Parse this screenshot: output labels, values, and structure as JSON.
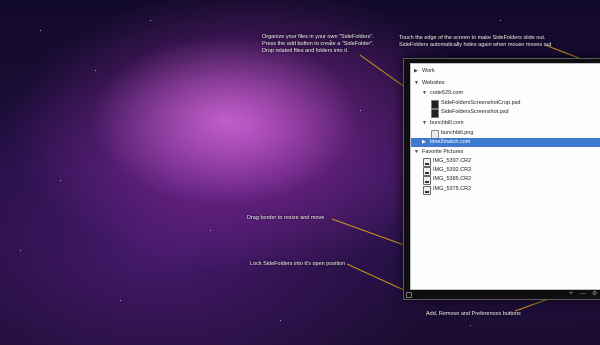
{
  "annotations": {
    "organize": "Organize your files in your own \"SideFolders\".\nPress the add button to create a \"SideFolder\".\nDrop related files and folders into it.",
    "touch_edge": "Touch the edge of the screen to make SideFolders slide out.\nSideFolders automatically hides again when mouse moves out",
    "drag_border": "Drag border to resize and move",
    "lock": "Lock SideFolders into it's open position",
    "buttons": "Add, Remove and Preferences buttons"
  },
  "sidefolders": {
    "tree": [
      {
        "label": "Work",
        "indent": 0,
        "toggle": "collapsed",
        "kind": "folder"
      },
      {
        "label": "Websites",
        "indent": 0,
        "toggle": "expanded",
        "kind": "folder"
      },
      {
        "label": "code529.com",
        "indent": 1,
        "toggle": "expanded",
        "kind": "folder"
      },
      {
        "label": "SideFoldersScreenshotCrop.psd",
        "indent": 2,
        "toggle": "none",
        "kind": "psd"
      },
      {
        "label": "SideFoldersScreenshot.psd",
        "indent": 2,
        "toggle": "none",
        "kind": "psd"
      },
      {
        "label": "bunchbill.com",
        "indent": 1,
        "toggle": "expanded",
        "kind": "folder"
      },
      {
        "label": "bunchbill.png",
        "indent": 2,
        "toggle": "none",
        "kind": "png"
      },
      {
        "label": "time2match.com",
        "indent": 1,
        "toggle": "collapsed",
        "kind": "folder",
        "selected": true
      },
      {
        "label": "Favorite Pictures",
        "indent": 0,
        "toggle": "expanded",
        "kind": "folder"
      },
      {
        "label": "IMG_5397.CR2",
        "indent": 1,
        "toggle": "none",
        "kind": "cr2"
      },
      {
        "label": "IMG_5392.CR2",
        "indent": 1,
        "toggle": "none",
        "kind": "cr2"
      },
      {
        "label": "IMG_5385.CR2",
        "indent": 1,
        "toggle": "none",
        "kind": "cr2"
      },
      {
        "label": "IMG_5375.CR2",
        "indent": 1,
        "toggle": "none",
        "kind": "cr2"
      }
    ],
    "buttons": {
      "add": "+",
      "remove": "—",
      "preferences": "⚙"
    },
    "icons": {
      "lock": "lock-icon"
    }
  }
}
